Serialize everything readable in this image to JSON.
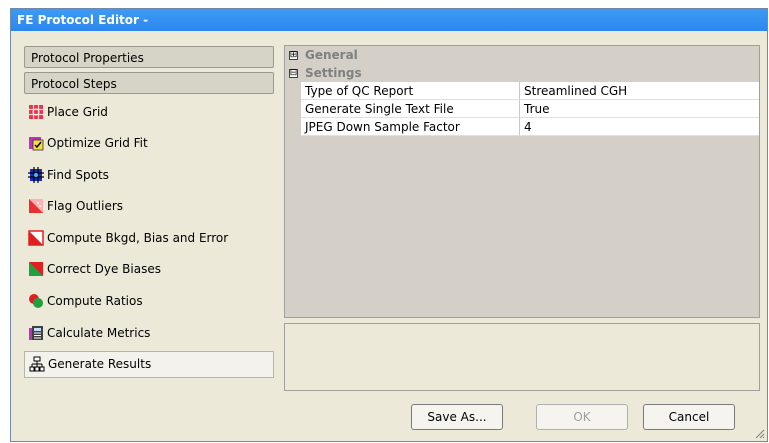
{
  "window": {
    "title": "FE Protocol Editor -"
  },
  "left_panel": {
    "tabs": [
      {
        "label": "Protocol Properties"
      },
      {
        "label": "Protocol Steps"
      }
    ],
    "steps": [
      {
        "label": "Place Grid",
        "icon": "place-grid-icon"
      },
      {
        "label": "Optimize Grid Fit",
        "icon": "optimize-grid-fit-icon"
      },
      {
        "label": "Find Spots",
        "icon": "find-spots-icon"
      },
      {
        "label": "Flag Outliers",
        "icon": "flag-outliers-icon"
      },
      {
        "label": "Compute Bkgd, Bias and Error",
        "icon": "compute-bkgd-icon"
      },
      {
        "label": "Correct Dye Biases",
        "icon": "correct-dye-biases-icon"
      },
      {
        "label": "Compute Ratios",
        "icon": "compute-ratios-icon"
      },
      {
        "label": "Calculate Metrics",
        "icon": "calculate-metrics-icon"
      },
      {
        "label": "Generate Results",
        "icon": "generate-results-icon",
        "selected": true
      }
    ]
  },
  "property_grid": {
    "categories": [
      {
        "label": "General",
        "expander": "⊞",
        "expanded": false
      },
      {
        "label": "Settings",
        "expander": "⊟",
        "expanded": true
      }
    ],
    "rows": [
      {
        "name": "Type of QC Report",
        "value": "Streamlined CGH"
      },
      {
        "name": "Generate Single Text File",
        "value": "True"
      },
      {
        "name": "JPEG Down Sample Factor",
        "value": "4"
      }
    ]
  },
  "buttons": {
    "save_as": "Save As...",
    "ok": "OK",
    "cancel": "Cancel"
  },
  "colors": {
    "titlebar": "#2c87ee",
    "panel_bg": "#ece9d8"
  }
}
